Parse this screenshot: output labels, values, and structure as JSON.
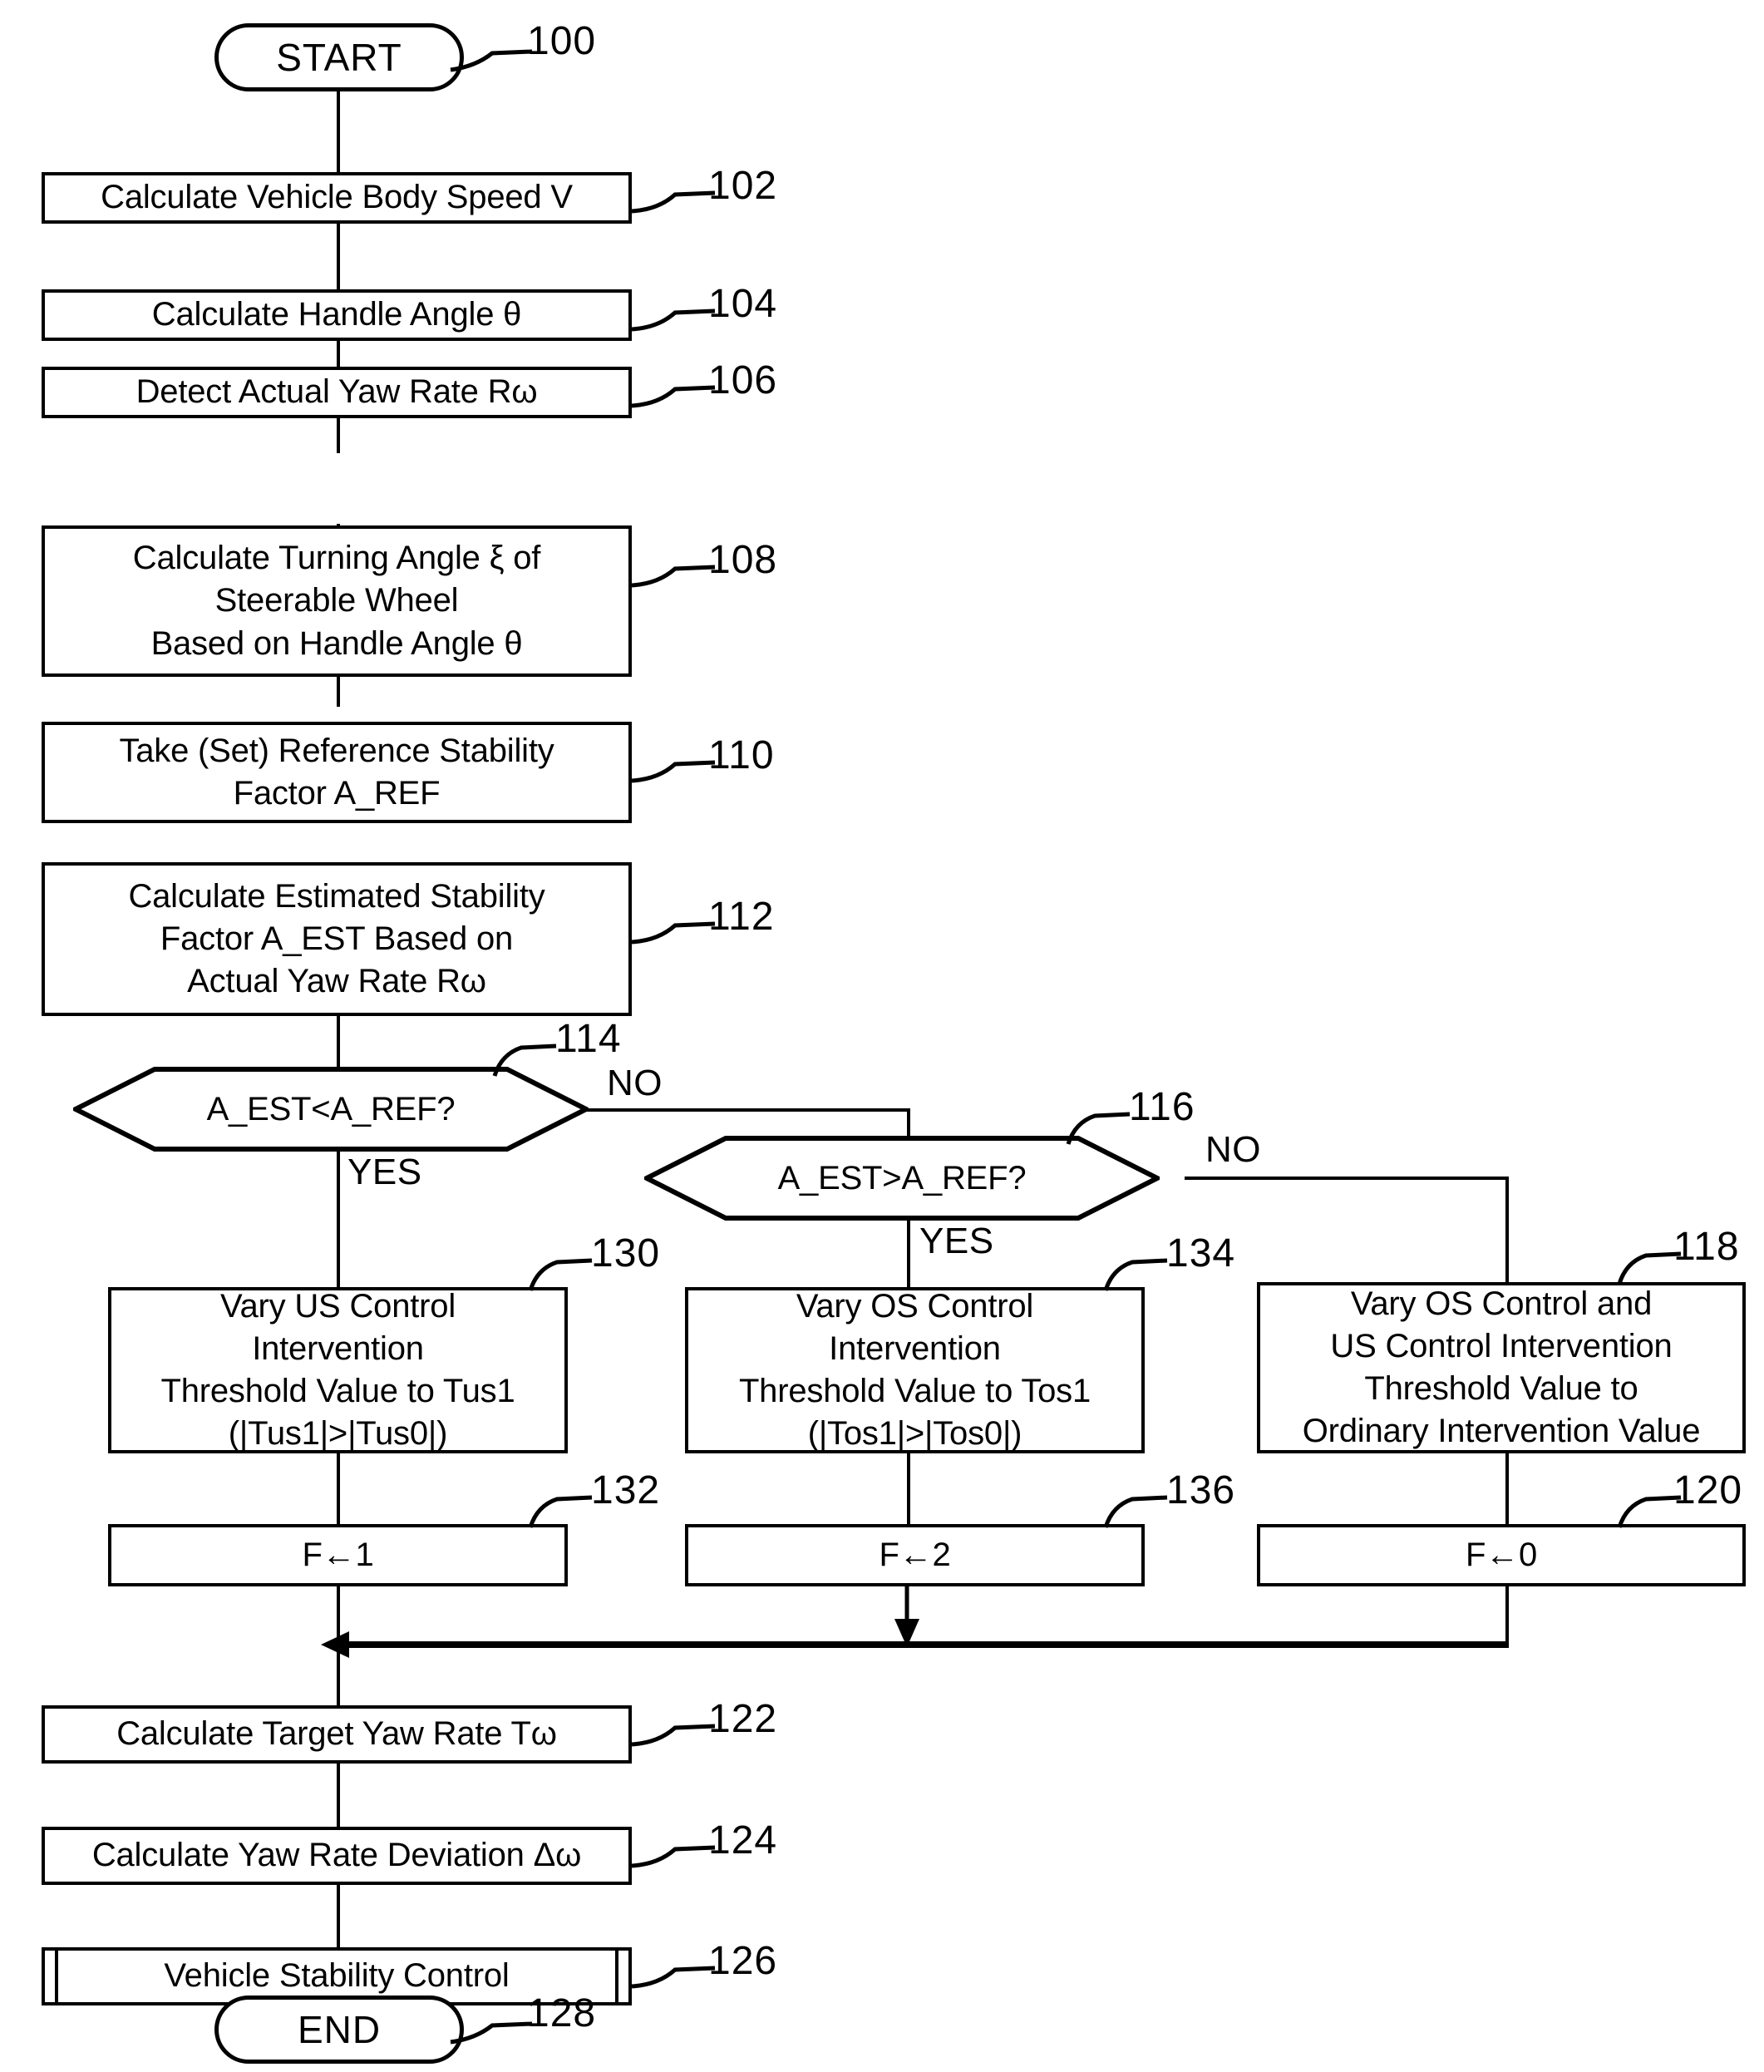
{
  "figure": {
    "type": "flowchart",
    "orientation": "vertical",
    "title": "Vehicle Stability Control Flowchart"
  },
  "nodes": [
    {
      "id": "100",
      "shape": "terminator",
      "label": "START"
    },
    {
      "id": "102",
      "shape": "process",
      "label": "Calculate Vehicle Body Speed V"
    },
    {
      "id": "104",
      "shape": "process",
      "label": "Calculate Handle Angle  θ"
    },
    {
      "id": "106",
      "shape": "process",
      "label": "Detect Actual Yaw Rate Rω"
    },
    {
      "id": "108",
      "shape": "process",
      "label": "Calculate Turning Angle  ξ  of\nSteerable Wheel\nBased on Handle Angle  θ"
    },
    {
      "id": "110",
      "shape": "process",
      "label": "Take (Set) Reference Stability\nFactor A_REF"
    },
    {
      "id": "112",
      "shape": "process",
      "label": "Calculate Estimated Stability\nFactor A_EST Based on\nActual Yaw Rate Rω"
    },
    {
      "id": "114",
      "shape": "decision",
      "label": "A_EST<A_REF?"
    },
    {
      "id": "116",
      "shape": "decision",
      "label": "A_EST>A_REF?"
    },
    {
      "id": "130",
      "shape": "process",
      "label": "Vary US Control\nIntervention\nThreshold Value to Tus1\n(|Tus1|>|Tus0|)"
    },
    {
      "id": "134",
      "shape": "process",
      "label": "Vary OS Control\nIntervention\nThreshold Value to Tos1\n(|Tos1|>|Tos0|)"
    },
    {
      "id": "118",
      "shape": "process",
      "label": "Vary OS Control and\nUS Control Intervention\nThreshold Value to\nOrdinary Intervention Value"
    },
    {
      "id": "132",
      "shape": "process",
      "label": "F←1"
    },
    {
      "id": "136",
      "shape": "process",
      "label": "F←2"
    },
    {
      "id": "120",
      "shape": "process",
      "label": "F←0"
    },
    {
      "id": "122",
      "shape": "process",
      "label": "Calculate Target Yaw Rate Tω"
    },
    {
      "id": "124",
      "shape": "process",
      "label": "Calculate Yaw Rate Deviation  Δω"
    },
    {
      "id": "126",
      "shape": "predefined-process",
      "label": "Vehicle Stability Control"
    },
    {
      "id": "128",
      "shape": "terminator",
      "label": "END"
    }
  ],
  "reference_numerals": {
    "n100": "100",
    "n102": "102",
    "n104": "104",
    "n106": "106",
    "n108": "108",
    "n110": "110",
    "n112": "112",
    "n114": "114",
    "n116": "116",
    "n118": "118",
    "n120": "120",
    "n122": "122",
    "n124": "124",
    "n126": "126",
    "n128": "128",
    "n130": "130",
    "n132": "132",
    "n134": "134",
    "n136": "136"
  },
  "branch_labels": {
    "d114_no": "NO",
    "d114_yes": "YES",
    "d116_no": "NO",
    "d116_yes": "YES"
  },
  "node_text": {
    "start": "START",
    "end": "END",
    "s102": "Calculate Vehicle Body Speed V",
    "s104": "Calculate Handle Angle  θ",
    "s106": "Detect Actual Yaw Rate Rω",
    "s108": "Calculate Turning Angle  ξ  of\nSteerable Wheel\nBased on Handle Angle  θ",
    "s110": "Take (Set) Reference Stability\nFactor A_REF",
    "s112": "Calculate Estimated Stability\nFactor A_EST Based on\nActual Yaw Rate Rω",
    "d114": "A_EST<A_REF?",
    "d116": "A_EST>A_REF?",
    "s130": "Vary US Control\nIntervention\nThreshold Value to Tus1\n(|Tus1|>|Tus0|)",
    "s134": "Vary OS Control\nIntervention\nThreshold Value to Tos1\n(|Tos1|>|Tos0|)",
    "s118": "Vary OS Control and\nUS Control Intervention\nThreshold Value to\nOrdinary Intervention Value",
    "s132": "F←1",
    "s136": "F←2",
    "s120": "F←0",
    "s122": "Calculate Target Yaw Rate Tω",
    "s124": "Calculate Yaw Rate Deviation  Δω",
    "s126": "Vehicle Stability Control"
  },
  "colors": {
    "ink": "#000000",
    "paper": "#ffffff"
  }
}
